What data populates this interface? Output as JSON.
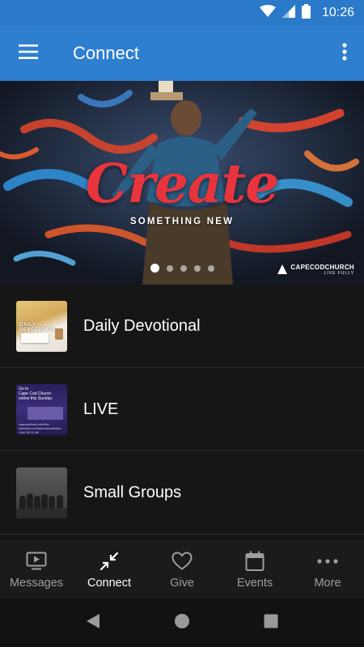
{
  "status_bar": {
    "time": "10:26",
    "icons": [
      "wifi-icon",
      "cell-signal-icon",
      "battery-icon"
    ]
  },
  "app_bar": {
    "title": "Connect",
    "menu_icon": "hamburger-menu-icon",
    "overflow_icon": "more-vertical-icon"
  },
  "hero": {
    "title": "Create",
    "subtitle": "SOMETHING NEW",
    "brand": "CAPECODCHURCH",
    "brand_sub": "LIVE FULLY",
    "slide_count": 5,
    "active_slide": 0
  },
  "list": {
    "items": [
      {
        "label": "Daily Devotional",
        "thumb_text": "DAILY DEVOTIONAL"
      },
      {
        "label": "LIVE",
        "thumb_text": "Go to\nCape Cod Church\nonline this Sunday:",
        "thumb_small": "capecodchurch.com/live\nfacebook.com/capecodchurch/live\n9 AM   OR   11 AM"
      },
      {
        "label": "Small Groups"
      }
    ]
  },
  "bottom_nav": {
    "items": [
      {
        "label": "Messages",
        "icon": "tv-play-icon",
        "active": false
      },
      {
        "label": "Connect",
        "icon": "arrows-collapse-icon",
        "active": true
      },
      {
        "label": "Give",
        "icon": "heart-icon",
        "active": false
      },
      {
        "label": "Events",
        "icon": "calendar-icon",
        "active": false
      },
      {
        "label": "More",
        "icon": "more-horizontal-icon",
        "active": false
      }
    ]
  },
  "colors": {
    "primary": "#2f7fd0",
    "status_bar": "#2a7ac9",
    "background": "#151515",
    "hero_title": "#e8353d"
  }
}
